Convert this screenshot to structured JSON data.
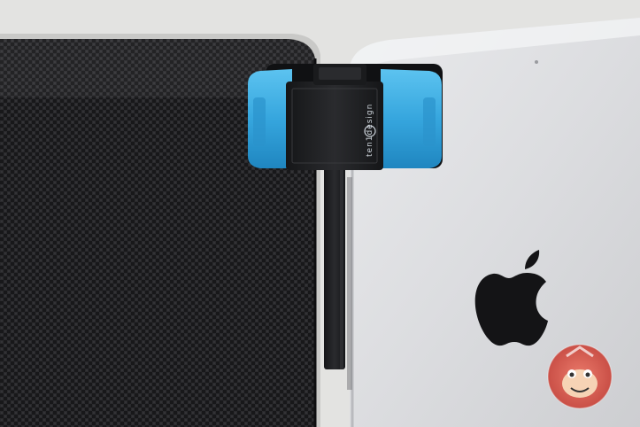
{
  "photo": {
    "clip_brand": "ten1design",
    "watermark_icon": "monkey-face-icon",
    "logo_icon": "apple-logo-icon",
    "colors": {
      "background": "#dcdcda",
      "carbon_case": "#1b1b1d",
      "ipad_silver": "#dedfe1",
      "clip_blue": "#3aa9e0",
      "clip_black": "#1e1f22",
      "watermark_red": "#d8463a"
    }
  }
}
